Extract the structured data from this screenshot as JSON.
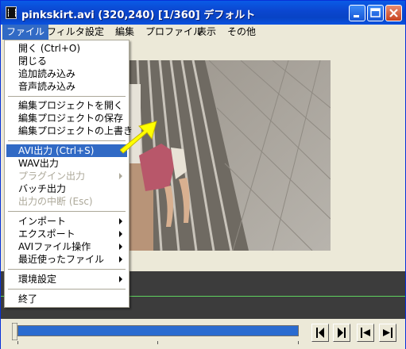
{
  "window": {
    "title": "pinkskirt.avi (320,240) [1/360] デフォルト",
    "buttons": {
      "minimize": "_",
      "maximize": "□",
      "close": "✕"
    }
  },
  "menubar": [
    "ファイル",
    "フィルタ",
    "設定",
    "編集",
    "プロファイル",
    "表示",
    "その他"
  ],
  "file_menu": {
    "open": "開く (Ctrl+O)",
    "close": "閉じる",
    "append": "追加読み込み",
    "audio_load": "音声読み込み",
    "project_open": "編集プロジェクトを開く",
    "project_save": "編集プロジェクトの保存",
    "project_overwrite": "編集プロジェクトの上書き",
    "avi_output": "AVI出力 (Ctrl+S)",
    "wav_output": "WAV出力",
    "plugin_output": "プラグイン出力",
    "batch_output": "バッチ出力",
    "cancel_output": "出力の中断 (Esc)",
    "import": "インポート",
    "export": "エクスポート",
    "avi_file_ops": "AVIファイル操作",
    "recent_files": "最近使ったファイル",
    "preferences": "環境設定",
    "exit": "終了"
  },
  "seekbar": {
    "position_fraction": 0.003
  },
  "colors": {
    "accent": "#316ac5",
    "titlebar": "#0a5be6",
    "seekbar": "#2a6bd0"
  },
  "icons": [
    "app-icon",
    "minimize-icon",
    "maximize-icon",
    "close-icon",
    "arrow-pointer-icon",
    "step-back-icon",
    "step-forward-icon",
    "jump-start-icon",
    "jump-end-icon"
  ]
}
